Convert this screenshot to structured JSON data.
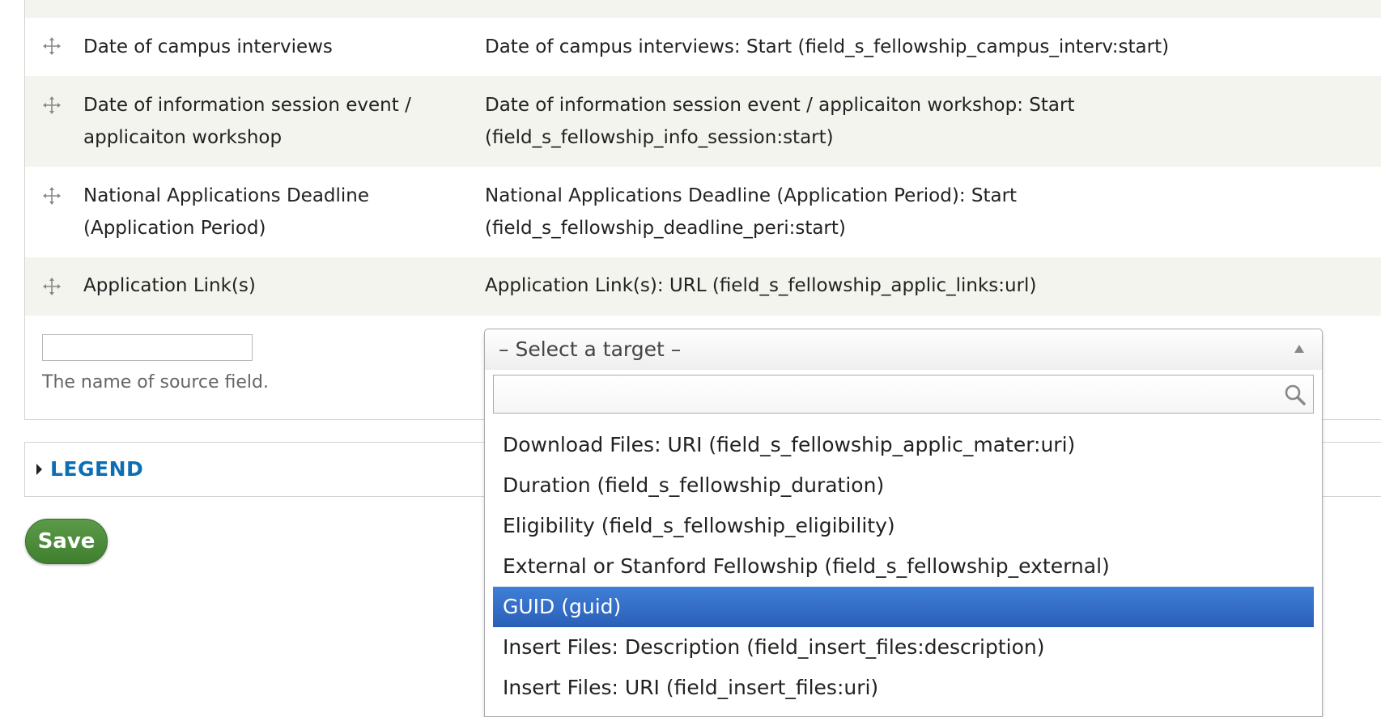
{
  "mapping": {
    "rows": [
      {
        "source": "Date of campus interviews",
        "target": "Date of campus interviews: Start (field_s_fellowship_campus_interv:start)"
      },
      {
        "source": "Date of information session event / applicaiton workshop",
        "target": "Date of information session event / applicaiton workshop: Start (field_s_fellowship_info_session:start)"
      },
      {
        "source": "National Applications Deadline (Application Period)",
        "target": "National Applications Deadline (Application Period): Start (field_s_fellowship_deadline_peri:start)"
      },
      {
        "source": "Application Link(s)",
        "target": "Application Link(s): URL (field_s_fellowship_applic_links:url)"
      }
    ],
    "new_row": {
      "source_value": "",
      "help_text": "The name of source field."
    }
  },
  "target_select": {
    "selected": "– Select a target –",
    "search_value": "",
    "options": [
      "Download Files: URI (field_s_fellowship_applic_mater:uri)",
      "Duration (field_s_fellowship_duration)",
      "Eligibility (field_s_fellowship_eligibility)",
      "External or Stanford Fellowship (field_s_fellowship_external)",
      "GUID (guid)",
      "Insert Files: Description (field_insert_files:description)",
      "Insert Files: URI (field_insert_files:uri)"
    ],
    "highlighted_option": "GUID (guid)"
  },
  "legend": {
    "label": "LEGEND"
  },
  "actions": {
    "save_label": "Save"
  },
  "colors": {
    "row_stripe": "#f3f4ee",
    "legend_link": "#0c6fb3",
    "save_button": "#4a8a3b",
    "highlight": "#3470cc"
  },
  "icons": {
    "drag_handle": "drag-handle-icon",
    "search": "search-icon",
    "legend_toggle": "caret-right-icon",
    "select_arrow": "triangle-up-icon"
  }
}
